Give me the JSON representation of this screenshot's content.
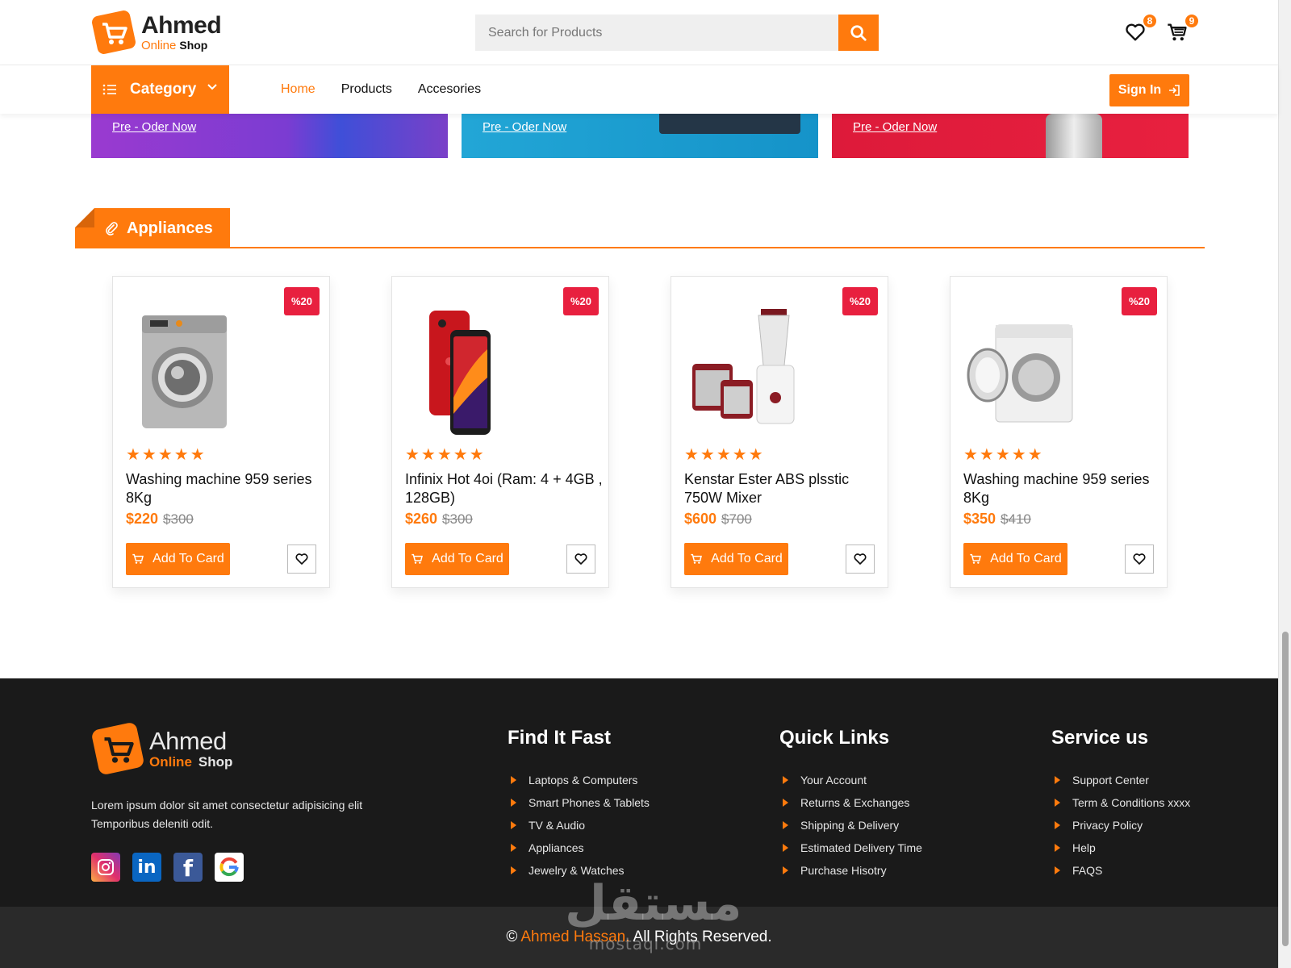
{
  "brand": {
    "name": "Ahmed",
    "sub_online": "Online",
    "sub_shop": "Shop"
  },
  "header": {
    "search_placeholder": "Search for Products",
    "wishlist_count": "8",
    "cart_count": "9"
  },
  "nav": {
    "category_label": "Category",
    "links": [
      "Home",
      "Products",
      "Accesories"
    ],
    "signin_label": "Sign In"
  },
  "banners": [
    "Pre - Oder Now",
    "Pre - Oder Now",
    "Pre - Oder Now"
  ],
  "section": {
    "title": "Appliances"
  },
  "products": [
    {
      "discount": "%20",
      "name": "Washing machine 959 series 8Kg",
      "price": "$220",
      "old_price": "$300",
      "rating": 5,
      "add_label": "Add To Card",
      "image": "washing-machine-front-load"
    },
    {
      "discount": "%20",
      "name": "Infinix Hot 4oi (Ram: 4 + 4GB , 128GB)",
      "price": "$260",
      "old_price": "$300",
      "rating": 5,
      "add_label": "Add To Card",
      "image": "red-smartphone"
    },
    {
      "discount": "%20",
      "name": "Kenstar Ester ABS plsstic 750W Mixer",
      "price": "$600",
      "old_price": "$700",
      "rating": 5,
      "add_label": "Add To Card",
      "image": "mixer-grinder"
    },
    {
      "discount": "%20",
      "name": "Washing machine 959 series 8Kg",
      "price": "$350",
      "old_price": "$410",
      "rating": 5,
      "add_label": "Add To Card",
      "image": "washing-machine-open-door"
    }
  ],
  "footer": {
    "description": "Lorem ipsum dolor sit amet consectetur adipisicing elit Temporibus deleniti odit.",
    "socials": [
      "instagram-icon",
      "linkedin-icon",
      "facebook-icon",
      "google-icon"
    ],
    "columns": [
      {
        "title": "Find It Fast",
        "items": [
          "Laptops & Computers",
          "Smart Phones & Tablets",
          "TV & Audio",
          "Appliances",
          "Jewelry & Watches"
        ]
      },
      {
        "title": "Quick Links",
        "items": [
          "Your Account",
          "Returns & Exchanges",
          "Shipping & Delivery",
          "Estimated Delivery Time",
          "Purchase Hisotry"
        ]
      },
      {
        "title": "Service us",
        "items": [
          "Support Center",
          "Term & Conditions xxxx",
          "Privacy Policy",
          "Help",
          "FAQS"
        ]
      }
    ],
    "copyright_symbol": "©",
    "copyright_name": "Ahmed Hassan.",
    "copyright_text": "All Rights Reserved."
  },
  "watermark": {
    "arabic": "مستقل",
    "latin": "mostaql.com"
  },
  "colors": {
    "accent": "#ff7a0d",
    "discount": "#e8203f",
    "footer_bg": "#1a1a1a"
  }
}
